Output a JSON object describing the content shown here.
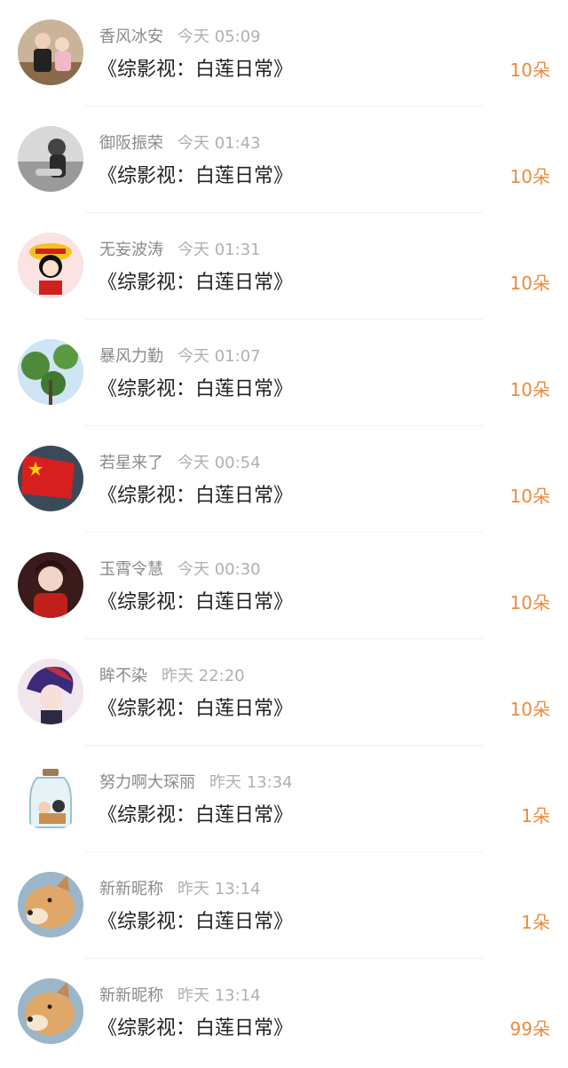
{
  "accent_color": "#ef8a3b",
  "rows": [
    {
      "username": "香风冰安",
      "time": "今天 05:09",
      "book": "《综影视：白莲日常》",
      "amount": "10朵",
      "avatar_icon": "person-avatar-icon"
    },
    {
      "username": "御阪振荣",
      "time": "今天 01:43",
      "book": "《综影视：白莲日常》",
      "amount": "10朵",
      "avatar_icon": "person-photo-avatar-icon"
    },
    {
      "username": "无妄波涛",
      "time": "今天 01:31",
      "book": "《综影视：白莲日常》",
      "amount": "10朵",
      "avatar_icon": "cartoon-avatar-icon"
    },
    {
      "username": "暴风力勤",
      "time": "今天 01:07",
      "book": "《综影视：白莲日常》",
      "amount": "10朵",
      "avatar_icon": "tree-avatar-icon"
    },
    {
      "username": "若星来了",
      "time": "今天 00:54",
      "book": "《综影视：白莲日常》",
      "amount": "10朵",
      "avatar_icon": "flag-avatar-icon"
    },
    {
      "username": "玉霄令慧",
      "time": "今天 00:30",
      "book": "《综影视：白莲日常》",
      "amount": "10朵",
      "avatar_icon": "portrait-avatar-icon"
    },
    {
      "username": "眸不染",
      "time": "昨天 22:20",
      "book": "《综影视：白莲日常》",
      "amount": "10朵",
      "avatar_icon": "anime-avatar-icon"
    },
    {
      "username": "努力啊大琛丽",
      "time": "昨天 13:34",
      "book": "《综影视：白莲日常》",
      "amount": "1朵",
      "avatar_icon": "jar-avatar-icon"
    },
    {
      "username": "新新昵称",
      "time": "昨天 13:14",
      "book": "《综影视：白莲日常》",
      "amount": "1朵",
      "avatar_icon": "dog-avatar-icon"
    },
    {
      "username": "新新昵称",
      "time": "昨天 13:14",
      "book": "《综影视：白莲日常》",
      "amount": "99朵",
      "avatar_icon": "dog-avatar-icon"
    }
  ]
}
